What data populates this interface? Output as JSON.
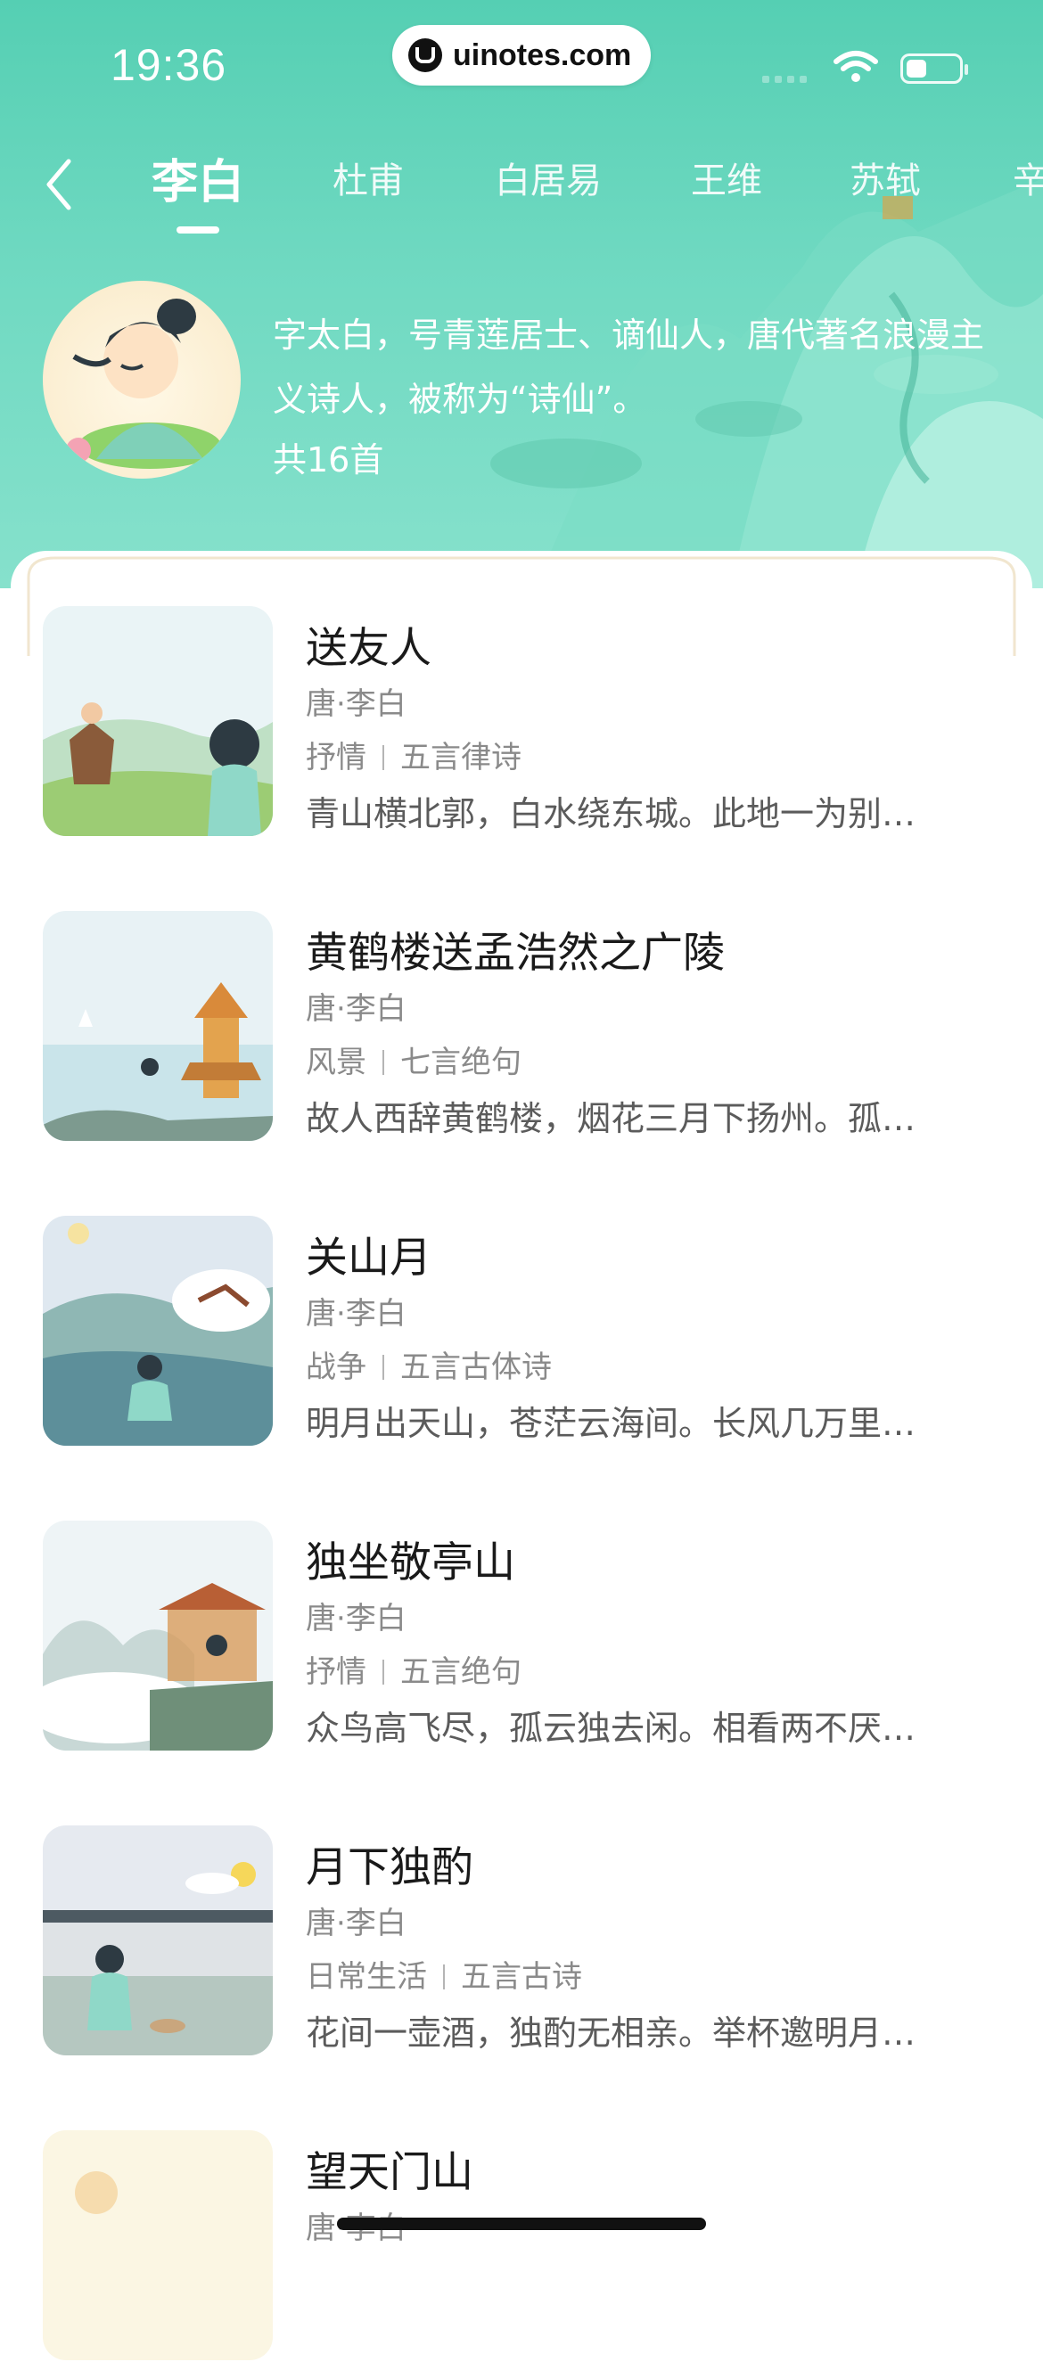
{
  "status_bar": {
    "time": "19:36",
    "watermark": "uinotes.com"
  },
  "nav": {
    "back_icon": "chevron-left-icon",
    "tabs": [
      {
        "label": "李白",
        "active": true
      },
      {
        "label": "杜甫",
        "active": false
      },
      {
        "label": "白居易",
        "active": false
      },
      {
        "label": "王维",
        "active": false
      },
      {
        "label": "苏轼",
        "active": false
      },
      {
        "label": "辛",
        "active": false
      }
    ]
  },
  "author": {
    "description": "字太白，号青莲居士、谪仙人，唐代著名浪漫主义诗人，被称为“诗仙”。",
    "count": "共16首"
  },
  "poems": [
    {
      "title": "送友人",
      "author": "唐·李白",
      "tag1": "抒情",
      "tag2": "五言律诗",
      "lines": "青山横北郭，白水绕东城。此地一为别…"
    },
    {
      "title": "黄鹤楼送孟浩然之广陵",
      "author": "唐·李白",
      "tag1": "风景",
      "tag2": "七言绝句",
      "lines": "故人西辞黄鹤楼，烟花三月下扬州。孤…"
    },
    {
      "title": "关山月",
      "author": "唐·李白",
      "tag1": "战争",
      "tag2": "五言古体诗",
      "lines": "明月出天山，苍茫云海间。长风几万里…"
    },
    {
      "title": "独坐敬亭山",
      "author": "唐·李白",
      "tag1": "抒情",
      "tag2": "五言绝句",
      "lines": "众鸟高飞尽，孤云独去闲。相看两不厌…"
    },
    {
      "title": "月下独酌",
      "author": "唐·李白",
      "tag1": "日常生活",
      "tag2": "五言古诗",
      "lines": "花间一壶酒，独酌无相亲。举杯邀明月…"
    },
    {
      "title": "望天门山",
      "author": "唐·李白",
      "tag1": "",
      "tag2": "",
      "lines": ""
    }
  ],
  "colors": {
    "header_teal": "#55cfb3",
    "text_primary": "#1a1a1a",
    "text_secondary": "#8a8a8a"
  }
}
